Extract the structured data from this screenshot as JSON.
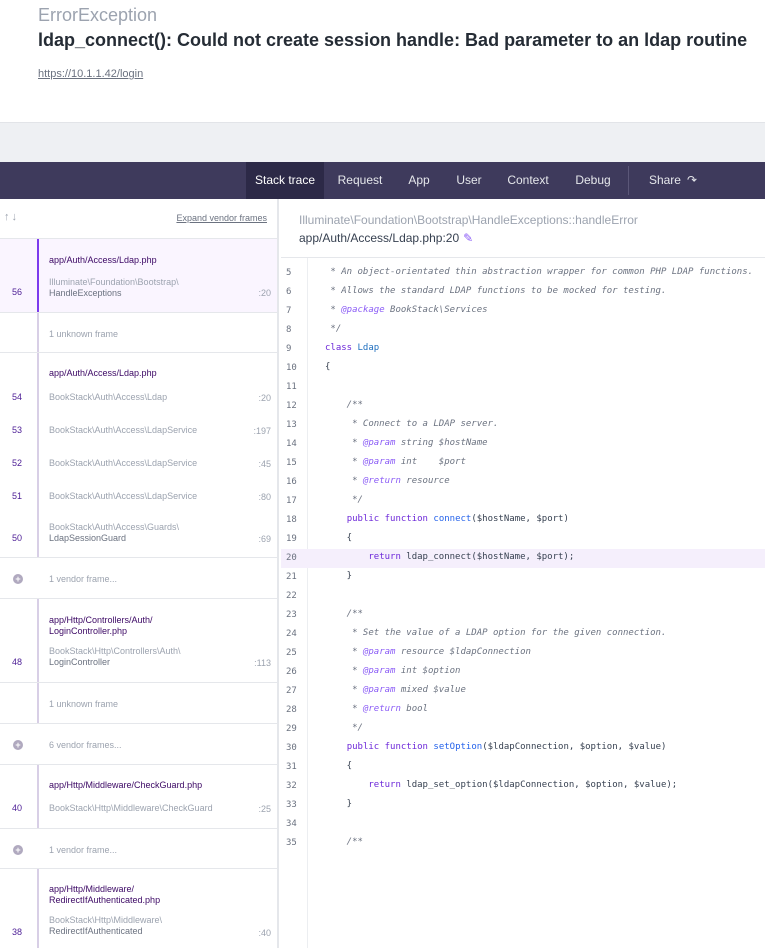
{
  "header": {
    "exception_class": "ErrorException",
    "message": "ldap_connect(): Could not create session handle: Bad parameter to an ldap routine",
    "url": "https://10.1.1.42/login"
  },
  "nav": {
    "tabs": [
      "Stack trace",
      "Request",
      "App",
      "User",
      "Context",
      "Debug"
    ],
    "active_tab": "Stack trace",
    "share": "Share"
  },
  "sidebar": {
    "expand_label": "Expand vendor frames",
    "groups": [
      {
        "title": "app/Auth/Access/Ldap.php",
        "frames": [
          {
            "line": "56",
            "class": "Illuminate\\Foundation\\Bootstrap\\",
            "class2": "HandleExceptions",
            "col": ":20"
          }
        ]
      },
      {
        "muted": "1 unknown frame"
      },
      {
        "title": "app/Auth/Access/Ldap.php",
        "frames": [
          {
            "line": "54",
            "class": "BookStack\\Auth\\Access\\Ldap",
            "col": ":20"
          },
          {
            "line": "53",
            "class": "BookStack\\Auth\\Access\\LdapService",
            "col": ":197"
          },
          {
            "line": "52",
            "class": "BookStack\\Auth\\Access\\LdapService",
            "col": ":45"
          },
          {
            "line": "51",
            "class": "BookStack\\Auth\\Access\\LdapService",
            "col": ":80"
          },
          {
            "line": "50",
            "class": "BookStack\\Auth\\Access\\Guards\\",
            "class2": "LdapSessionGuard",
            "col": ":69"
          }
        ]
      },
      {
        "vendor": "1 vendor frame..."
      },
      {
        "title": "app/Http/Controllers/Auth/",
        "title2": "LoginController.php",
        "frames": [
          {
            "line": "48",
            "class": "BookStack\\Http\\Controllers\\Auth\\",
            "class2": "LoginController",
            "col": ":113"
          }
        ]
      },
      {
        "muted": "1 unknown frame"
      },
      {
        "vendor": "6 vendor frames..."
      },
      {
        "title": "app/Http/Middleware/CheckGuard.php",
        "frames": [
          {
            "line": "40",
            "class": "BookStack\\Http\\Middleware\\CheckGuard",
            "col": ":25"
          }
        ]
      },
      {
        "vendor": "1 vendor frame..."
      },
      {
        "title": "app/Http/Middleware/",
        "title2": "RedirectIfAuthenticated.php",
        "frames": [
          {
            "line": "38",
            "class": "BookStack\\Http\\Middleware\\",
            "class2": "RedirectIfAuthenticated",
            "col": ":40"
          }
        ]
      }
    ]
  },
  "detail": {
    "class": "Illuminate\\Foundation\\Bootstrap\\HandleExceptions::handleError",
    "file_prefix": "app/Auth/Access/",
    "file_name": "Ldap.php",
    "file_line": ":20"
  },
  "code": {
    "highlight_line": 20,
    "lines": [
      {
        "n": "5",
        "t": " * An object-orientated thin abstraction wrapper for common PHP LDAP functions."
      },
      {
        "n": "6",
        "t": " * Allows the standard LDAP functions to be mocked for testing."
      },
      {
        "n": "7",
        "t": " * @package BookStack\\Services"
      },
      {
        "n": "8",
        "t": " */"
      },
      {
        "n": "9",
        "t": "class Ldap"
      },
      {
        "n": "10",
        "t": "{"
      },
      {
        "n": "11",
        "t": ""
      },
      {
        "n": "12",
        "t": "    /**"
      },
      {
        "n": "13",
        "t": "     * Connect to a LDAP server."
      },
      {
        "n": "14",
        "t": "     * @param string $hostName"
      },
      {
        "n": "15",
        "t": "     * @param int    $port"
      },
      {
        "n": "16",
        "t": "     * @return resource"
      },
      {
        "n": "17",
        "t": "     */"
      },
      {
        "n": "18",
        "t": "    public function connect($hostName, $port)"
      },
      {
        "n": "19",
        "t": "    {"
      },
      {
        "n": "20",
        "t": "        return ldap_connect($hostName, $port);"
      },
      {
        "n": "21",
        "t": "    }"
      },
      {
        "n": "22",
        "t": ""
      },
      {
        "n": "23",
        "t": "    /**"
      },
      {
        "n": "24",
        "t": "     * Set the value of a LDAP option for the given connection."
      },
      {
        "n": "25",
        "t": "     * @param resource $ldapConnection"
      },
      {
        "n": "26",
        "t": "     * @param int $option"
      },
      {
        "n": "27",
        "t": "     * @param mixed $value"
      },
      {
        "n": "28",
        "t": "     * @return bool"
      },
      {
        "n": "29",
        "t": "     */"
      },
      {
        "n": "30",
        "t": "    public function setOption($ldapConnection, $option, $value)"
      },
      {
        "n": "31",
        "t": "    {"
      },
      {
        "n": "32",
        "t": "        return ldap_set_option($ldapConnection, $option, $value);"
      },
      {
        "n": "33",
        "t": "    }"
      },
      {
        "n": "34",
        "t": ""
      },
      {
        "n": "35",
        "t": "    /**"
      }
    ]
  },
  "icons": {
    "sort": "sort-arrows-icon",
    "share": "share-arrow-icon",
    "edit": "pencil-icon",
    "expand": "plus-circle-icon"
  }
}
